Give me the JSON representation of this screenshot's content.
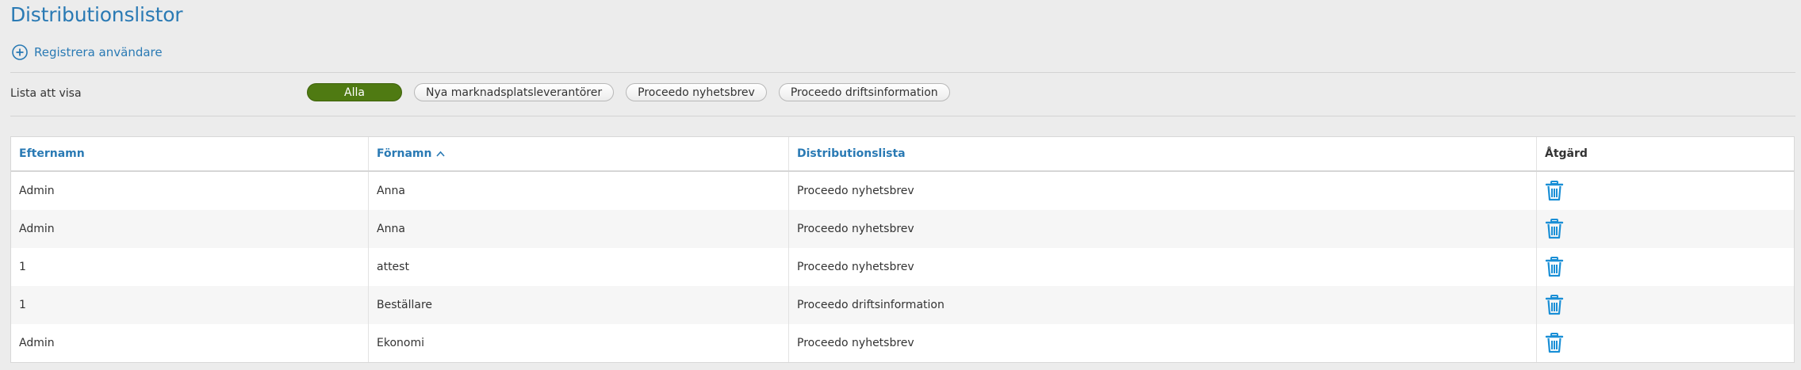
{
  "page": {
    "title": "Distributionslistor"
  },
  "register": {
    "label": "Registrera användare",
    "icon": "plus-circle-icon"
  },
  "filter": {
    "label": "Lista att visa",
    "options": [
      {
        "label": "Alla",
        "active": true
      },
      {
        "label": "Nya marknadsplatsleverantörer",
        "active": false
      },
      {
        "label": "Proceedo nyhetsbrev",
        "active": false
      },
      {
        "label": "Proceedo driftsinformation",
        "active": false
      }
    ]
  },
  "table": {
    "columns": {
      "efternamn": "Efternamn",
      "fornamn": "Förnamn",
      "distributionslista": "Distributionslista",
      "atgard": "Åtgärd"
    },
    "sorted_column": "fornamn",
    "sort_direction": "ascending",
    "rows": [
      {
        "efternamn": "Admin",
        "fornamn": "Anna",
        "distributionslista": "Proceedo nyhetsbrev"
      },
      {
        "efternamn": "Admin",
        "fornamn": "Anna",
        "distributionslista": "Proceedo nyhetsbrev"
      },
      {
        "efternamn": "1",
        "fornamn": "attest",
        "distributionslista": "Proceedo nyhetsbrev"
      },
      {
        "efternamn": "1",
        "fornamn": "Beställare",
        "distributionslista": "Proceedo driftsinformation"
      },
      {
        "efternamn": "Admin",
        "fornamn": "Ekonomi",
        "distributionslista": "Proceedo nyhetsbrev"
      }
    ],
    "action_icon": "trash-icon"
  },
  "colors": {
    "accent": "#2a7ab4",
    "active_pill": "#4f7a12",
    "action_icon": "#1a8fd6",
    "background": "#ececec"
  }
}
